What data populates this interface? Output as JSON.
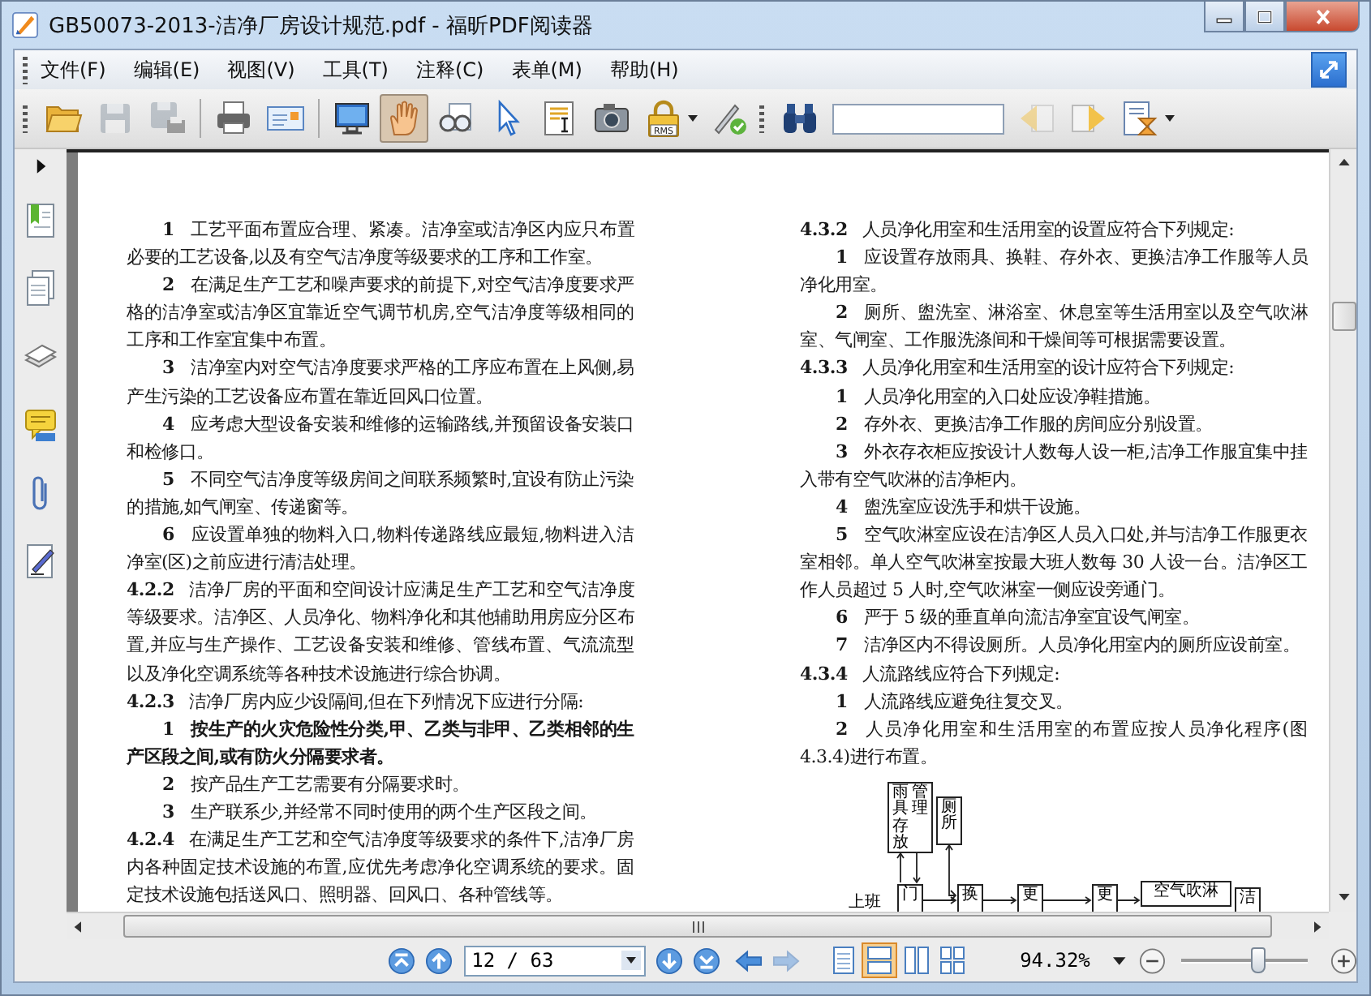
{
  "window": {
    "title": "GB50073-2013-洁净厂房设计规范.pdf - 福昕PDF阅读器"
  },
  "menu": [
    "文件(F)",
    "编辑(E)",
    "视图(V)",
    "工具(T)",
    "注释(C)",
    "表单(M)",
    "帮助(H)"
  ],
  "toolbar": {
    "groups": [
      {
        "tools": [
          {
            "kind": "open",
            "selected": false,
            "disabled": false,
            "dropdown": false
          },
          {
            "kind": "save",
            "selected": false,
            "disabled": true,
            "dropdown": false
          },
          {
            "kind": "save_as",
            "selected": false,
            "disabled": true,
            "dropdown": false
          }
        ]
      },
      {
        "tools": [
          {
            "kind": "print",
            "selected": false,
            "disabled": false,
            "dropdown": false
          },
          {
            "kind": "properties",
            "selected": false,
            "disabled": false,
            "dropdown": false
          }
        ]
      },
      {
        "tools": [
          {
            "kind": "fullscreen",
            "selected": false,
            "disabled": false,
            "dropdown": false
          },
          {
            "kind": "hand",
            "selected": true,
            "disabled": false,
            "dropdown": false
          },
          {
            "kind": "zoom",
            "selected": false,
            "disabled": false,
            "dropdown": false
          },
          {
            "kind": "select",
            "selected": false,
            "disabled": false,
            "dropdown": false
          },
          {
            "kind": "text_select",
            "selected": false,
            "disabled": false,
            "dropdown": false
          },
          {
            "kind": "snapshot",
            "selected": false,
            "disabled": false,
            "dropdown": false
          },
          {
            "kind": "rms",
            "label": "RMS",
            "selected": false,
            "disabled": false,
            "dropdown": true
          },
          {
            "kind": "sign",
            "selected": false,
            "disabled": false,
            "dropdown": false
          }
        ]
      },
      {
        "tools": [
          {
            "kind": "find",
            "selected": false,
            "disabled": false,
            "dropdown": false
          },
          {
            "kind": "field",
            "selected": false,
            "disabled": false,
            "dropdown": false
          },
          {
            "kind": "prev_result",
            "selected": false,
            "disabled": true,
            "dropdown": false
          },
          {
            "kind": "next_result",
            "selected": false,
            "disabled": false,
            "dropdown": false
          },
          {
            "kind": "search_options",
            "selected": false,
            "disabled": false,
            "dropdown": true
          }
        ]
      }
    ]
  },
  "sidebar": [
    {
      "kind": "bookmarks"
    },
    {
      "kind": "pages"
    },
    {
      "kind": "layers"
    },
    {
      "kind": "comments"
    },
    {
      "kind": "attachments"
    },
    {
      "kind": "signatures"
    }
  ],
  "document": {
    "columns": [
      [
        {
          "kind": "item",
          "num": "1",
          "text": "工艺平面布置应合理、紧凑。洁净室或洁净区内应只布置必要的工艺设备,以及有空气洁净度等级要求的工序和工作室。",
          "bold": false
        },
        {
          "kind": "item",
          "num": "2",
          "text": "在满足生产工艺和噪声要求的前提下,对空气洁净度要求严格的洁净室或洁净区宜靠近空气调节机房,空气洁净度等级相同的工序和工作室宜集中布置。",
          "bold": false
        },
        {
          "kind": "item",
          "num": "3",
          "text": "洁净室内对空气洁净度要求严格的工序应布置在上风侧,易产生污染的工艺设备应布置在靠近回风口位置。",
          "bold": false
        },
        {
          "kind": "item",
          "num": "4",
          "text": "应考虑大型设备安装和维修的运输路线,并预留设备安装口和检修口。",
          "bold": false
        },
        {
          "kind": "item",
          "num": "5",
          "text": "不同空气洁净度等级房间之间联系频繁时,宜设有防止污染的措施,如气闸室、传递窗等。",
          "bold": false
        },
        {
          "kind": "item",
          "num": "6",
          "text": "应设置单独的物料入口,物料传递路线应最短,物料进入洁净室(区)之前应进行清洁处理。",
          "bold": false
        },
        {
          "kind": "clause",
          "num": "4.2.2",
          "text": "洁净厂房的平面和空间设计应满足生产工艺和空气洁净度等级要求。洁净区、人员净化、物料净化和其他辅助用房应分区布置,并应与生产操作、工艺设备安装和维修、管线布置、气流流型以及净化空调系统等各种技术设施进行综合协调。",
          "bold": false
        },
        {
          "kind": "clause",
          "num": "4.2.3",
          "text": "洁净厂房内应少设隔间,但在下列情况下应进行分隔:",
          "bold": false
        },
        {
          "kind": "item",
          "num": "1",
          "text": "按生产的火灾危险性分类,甲、乙类与非甲、乙类相邻的生产区段之间,或有防火分隔要求者。",
          "bold": true
        },
        {
          "kind": "item",
          "num": "2",
          "text": "按产品生产工艺需要有分隔要求时。",
          "bold": false
        },
        {
          "kind": "item",
          "num": "3",
          "text": "生产联系少,并经常不同时使用的两个生产区段之间。",
          "bold": false
        },
        {
          "kind": "clause",
          "num": "4.2.4",
          "text": "在满足生产工艺和空气洁净度等级要求的条件下,洁净厂房内各种固定技术设施的布置,应优先考虑净化空调系统的要求。固定技术设施包括送风口、照明器、回风口、各种管线等。",
          "bold": false
        }
      ],
      [
        {
          "kind": "clause",
          "num": "4.3.2",
          "text": "人员净化用室和生活用室的设置应符合下列规定:",
          "bold": false
        },
        {
          "kind": "item",
          "num": "1",
          "text": "应设置存放雨具、换鞋、存外衣、更换洁净工作服等人员净化用室。",
          "bold": false
        },
        {
          "kind": "item",
          "num": "2",
          "text": "厕所、盥洗室、淋浴室、休息室等生活用室以及空气吹淋室、气闸室、工作服洗涤间和干燥间等可根据需要设置。",
          "bold": false
        },
        {
          "kind": "clause",
          "num": "4.3.3",
          "text": "人员净化用室和生活用室的设计应符合下列规定:",
          "bold": false
        },
        {
          "kind": "item",
          "num": "1",
          "text": "人员净化用室的入口处应设净鞋措施。",
          "bold": false
        },
        {
          "kind": "item",
          "num": "2",
          "text": "存外衣、更换洁净工作服的房间应分别设置。",
          "bold": false
        },
        {
          "kind": "item",
          "num": "3",
          "text": "外衣存衣柜应按设计人数每人设一柜,洁净工作服宜集中挂入带有空气吹淋的洁净柜内。",
          "bold": false
        },
        {
          "kind": "item",
          "num": "4",
          "text": "盥洗室应设洗手和烘干设施。",
          "bold": false
        },
        {
          "kind": "item",
          "num": "5",
          "text": "空气吹淋室应设在洁净区人员入口处,并与洁净工作服更衣室相邻。单人空气吹淋室按最大班人数每 30 人设一台。洁净区工作人员超过 5 人时,空气吹淋室一侧应设旁通门。",
          "bold": false
        },
        {
          "kind": "item",
          "num": "6",
          "text": "严于 5 级的垂直单向流洁净室宜设气闸室。",
          "bold": false
        },
        {
          "kind": "item",
          "num": "7",
          "text": "洁净区内不得设厕所。人员净化用室内的厕所应设前室。",
          "bold": false
        },
        {
          "kind": "clause",
          "num": "4.3.4",
          "text": "人流路线应符合下列规定:",
          "bold": false
        },
        {
          "kind": "item",
          "num": "1",
          "text": "人流路线应避免往复交叉。",
          "bold": false
        },
        {
          "kind": "item",
          "num": "2",
          "text": "人员净化用室和生活用室的布置应按人员净化程序(图4.3.4)进行布置。",
          "bold": false
        }
      ]
    ],
    "diagram": {
      "start_label": "上班",
      "nodes": [
        {
          "lines": [
            "雨具存放",
            "管理"
          ]
        },
        {
          "lines": [
            "厕所"
          ]
        },
        {
          "lines": [
            "门"
          ]
        },
        {
          "lines": [
            "换"
          ]
        },
        {
          "lines": [
            "更"
          ]
        },
        {
          "lines": [
            "更"
          ]
        },
        {
          "lines": [
            "空气吹淋"
          ]
        },
        {
          "lines": [
            "洁"
          ]
        }
      ]
    }
  },
  "navigation": {
    "buttons_before": [
      {
        "kind": "first",
        "disabled": false
      },
      {
        "kind": "prev",
        "disabled": false
      }
    ],
    "page_field": "12 / 63",
    "buttons_after": [
      {
        "kind": "next",
        "disabled": false
      },
      {
        "kind": "last",
        "disabled": false
      },
      {
        "kind": "back",
        "disabled": false
      },
      {
        "kind": "forward",
        "disabled": true
      }
    ],
    "view_modes": [
      {
        "kind": "single",
        "selected": false
      },
      {
        "kind": "continuous",
        "selected": true
      },
      {
        "kind": "facing",
        "selected": false
      },
      {
        "kind": "continuous_facing",
        "selected": false
      }
    ],
    "zoom": "94.32%",
    "zoom_slider": {
      "level": 0.6
    }
  }
}
